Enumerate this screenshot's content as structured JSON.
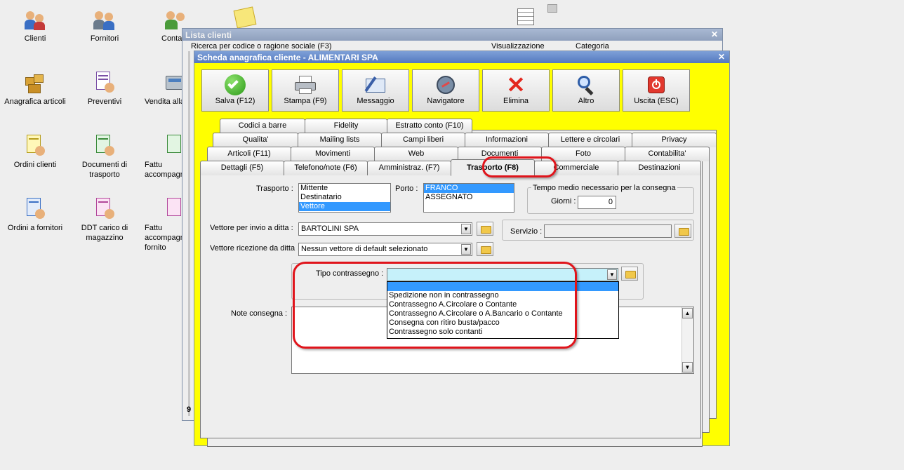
{
  "desktop": {
    "icons": [
      {
        "label": "Clienti",
        "icon": "customers-icon"
      },
      {
        "label": "Fornitori",
        "icon": "suppliers-icon"
      },
      {
        "label": "Conta",
        "icon": "contacts-icon"
      },
      {
        "label": "Anagrafica articoli",
        "icon": "boxes-icon"
      },
      {
        "label": "Preventivi",
        "icon": "quotes-icon"
      },
      {
        "label": "Vendita alla",
        "icon": "cash-register-icon"
      },
      {
        "label": "Ordini clienti",
        "icon": "customer-orders-icon"
      },
      {
        "label": "Documenti di trasporto",
        "icon": "transport-documents-icon"
      },
      {
        "label": "Fattu accompagn",
        "icon": "invoice-icon"
      },
      {
        "label": "Ordini a fornitori",
        "icon": "supplier-orders-icon"
      },
      {
        "label": "DDT carico di magazzino",
        "icon": "warehouse-ddt-icon"
      },
      {
        "label": "Fattu accompagn fornito",
        "icon": "supplier-invoice-icon"
      }
    ]
  },
  "back_window": {
    "title": "Lista clienti",
    "search_label": "Ricerca per codice o ragione sociale (F3)",
    "view_label": "Visualizzazione",
    "category_label": "Categoria",
    "footer_text": "9"
  },
  "window": {
    "title": "Scheda anagrafica cliente - ALIMENTARI SPA",
    "toolbar": [
      {
        "label": "Salva (F12)",
        "icon": "save-check-icon"
      },
      {
        "label": "Stampa (F9)",
        "icon": "printer-icon"
      },
      {
        "label": "Messaggio",
        "icon": "message-icon"
      },
      {
        "label": "Navigatore",
        "icon": "compass-icon"
      },
      {
        "label": "Elimina",
        "icon": "delete-x-icon"
      },
      {
        "label": "Altro",
        "icon": "search-magnifier-icon"
      },
      {
        "label": "Uscita (ESC)",
        "icon": "exit-power-icon"
      }
    ],
    "tabs": {
      "row1": [
        "Codici a barre",
        "Fidelity",
        "Estratto conto (F10)"
      ],
      "row2": [
        "Qualita'",
        "Mailing lists",
        "Campi liberi",
        "Informazioni",
        "Lettere e circolari",
        "Privacy"
      ],
      "row3": [
        "Articoli (F11)",
        "Movimenti",
        "Web",
        "Documenti",
        "Foto",
        "Contabilita'"
      ],
      "row4": [
        "Dettagli (F5)",
        "Telefono/note (F6)",
        "Amministraz. (F7)",
        "Trasporto (F8)",
        "Commerciale",
        "Destinazioni"
      ]
    },
    "transport": {
      "label": "Trasporto :",
      "options": [
        "Mittente",
        "Destinatario",
        "Vettore"
      ],
      "selected": "Vettore"
    },
    "porto": {
      "label": "Porto :",
      "options": [
        "FRANCO",
        "ASSEGNATO"
      ],
      "selected": "FRANCO"
    },
    "tempo": {
      "group_label": "Tempo medio necessario per la consegna",
      "giorni_label": "Giorni :",
      "giorni_value": "0"
    },
    "vettore_invio": {
      "label": "Vettore per invio a ditta :",
      "value": "BARTOLINI SPA"
    },
    "servizio": {
      "label": "Servizio :",
      "value": ""
    },
    "vettore_ricezione": {
      "label": "Vettore ricezione da ditta",
      "value": "Nessun vettore di default selezionato"
    },
    "contrassegno": {
      "label": "Tipo contrassegno :",
      "value": "",
      "options": [
        "",
        "Spedizione non in contrassegno",
        "Contrassegno A.Circolare o Contante",
        "Contrassegno A.Circolare o A.Bancario o Contante",
        "Consegna con ritiro busta/pacco",
        "Contrassegno solo contanti"
      ]
    },
    "note": {
      "label": "Note consegna :",
      "value": ""
    }
  },
  "colors": {
    "window_bg": "#ffff00",
    "highlight": "#e0141b",
    "selection": "#3399ff",
    "dropdown_field": "#c6f1fa"
  }
}
